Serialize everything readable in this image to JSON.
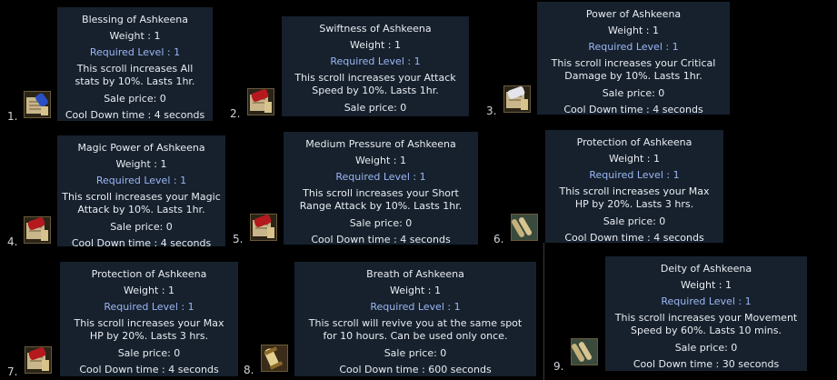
{
  "items": [
    {
      "num": "1.",
      "title": "Blessing of Ashkeena",
      "weight": "Weight : 1",
      "req": "Required Level : 1",
      "desc": [
        "This scroll increases All",
        "stats by 10%.  Lasts 1hr."
      ],
      "sale": "Sale price: 0",
      "cool": "Cool Down time : 4 seconds",
      "icon": "scroll-blue-icon"
    },
    {
      "num": "2.",
      "title": "Swiftness of Ashkeena",
      "weight": "Weight : 1",
      "req": "Required Level : 1",
      "desc": [
        "This scroll increases your Attack",
        "Speed by 10%.  Lasts 1hr."
      ],
      "sale": "Sale price: 0",
      "cool": "",
      "icon": "scroll-red-icon"
    },
    {
      "num": "3.",
      "title": "Power of Ashkeena",
      "weight": "Weight : 1",
      "req": "Required Level : 1",
      "desc": [
        "This scroll increases your Critical",
        "Damage by 10%.  Lasts 1hr."
      ],
      "sale": "Sale price: 0",
      "cool": "Cool Down time : 4 seconds",
      "icon": "scroll-white-icon"
    },
    {
      "num": "4.",
      "title": "Magic Power of Ashkeena",
      "weight": "Weight : 1",
      "req": "Required Level : 1",
      "desc": [
        "This scroll increases your Magic",
        "Attack by 10%.  Lasts 1hr."
      ],
      "sale": "Sale price: 0",
      "cool": "Cool Down time : 4 seconds",
      "icon": "scroll-red-icon"
    },
    {
      "num": "5.",
      "title": "Medium Pressure of Ashkeena",
      "weight": "Weight : 1",
      "req": "Required Level : 1",
      "desc": [
        "This scroll increases your Short",
        "Range Attack by 10%.  Lasts 1hr."
      ],
      "sale": "Sale price: 0",
      "cool": "Cool Down time : 4 seconds",
      "icon": "scroll-red-icon"
    },
    {
      "num": "6.",
      "title": "Protection of Ashkeena",
      "weight": "Weight : 1",
      "req": "Required Level : 1",
      "desc": [
        "This scroll increases your Max",
        "HP by 20%.  Lasts 3 hrs."
      ],
      "sale": "Sale price: 0",
      "cool": "Cool Down time : 4 seconds",
      "icon": "scroll-parchment-icon"
    },
    {
      "num": "7.",
      "title": "Protection of Ashkeena",
      "weight": "Weight : 1",
      "req": "Required Level : 1",
      "desc": [
        "This scroll increases your Max",
        "HP by 20%.  Lasts 3 hrs."
      ],
      "sale": "Sale price: 0",
      "cool": "Cool Down time : 4 seconds",
      "icon": "scroll-red-icon"
    },
    {
      "num": "8.",
      "title": "Breath of Ashkeena",
      "weight": "Weight : 1",
      "req": "Required Level : 1",
      "desc": [
        "This scroll will revive you at the same spot",
        "for 10 hours.  Can be used only once."
      ],
      "sale": "Sale price: 0",
      "cool": "Cool Down time : 600 seconds",
      "icon": "scroll-gold-icon"
    },
    {
      "num": "9.",
      "title": "Deity of Ashkeena",
      "weight": "Weight : 1",
      "req": "Required Level : 1",
      "desc": [
        "This scroll increases your Movement",
        "Speed by 60%.  Lasts 10 mins."
      ],
      "sale": "Sale price: 0",
      "cool": "Cool Down time : 30 seconds",
      "icon": "scroll-parchment-icon"
    }
  ]
}
